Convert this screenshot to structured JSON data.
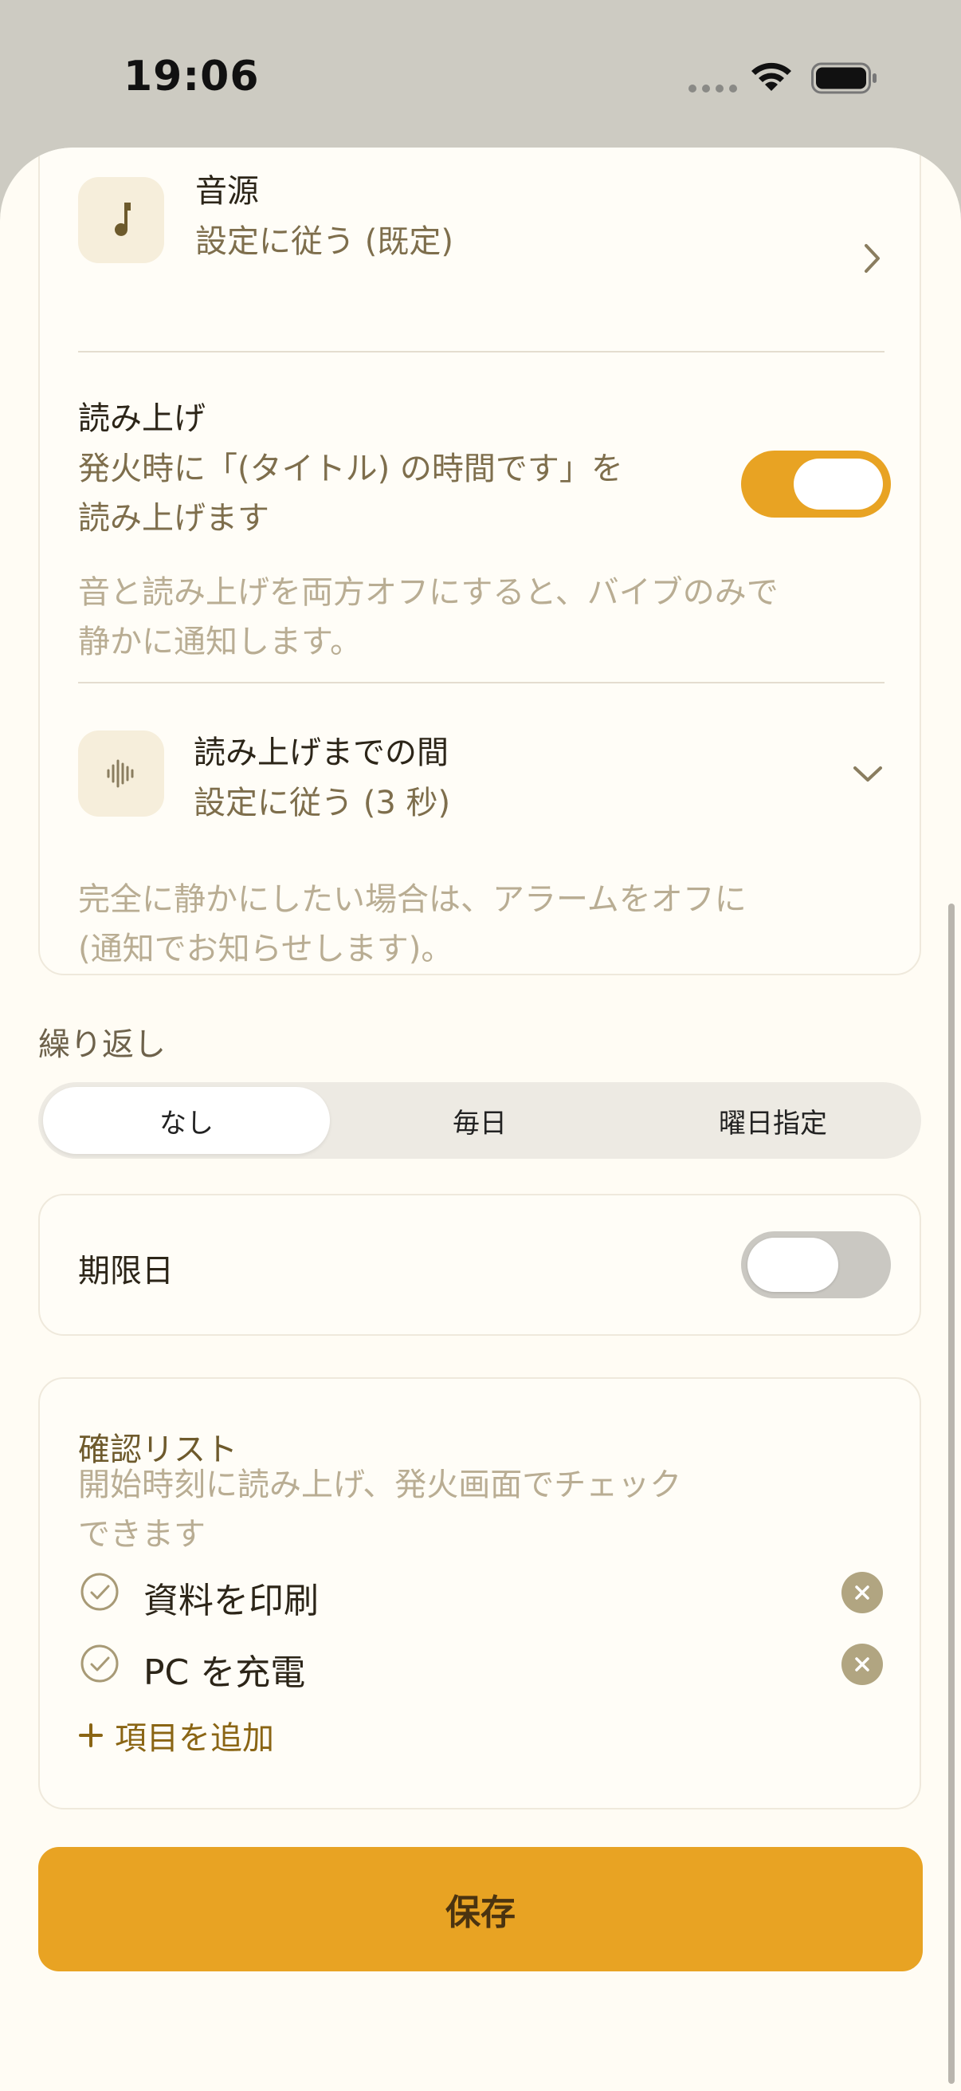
{
  "status_bar": {
    "time": "19:06"
  },
  "sound_row": {
    "title": "音源",
    "value": "設定に従う (既定)"
  },
  "readout_row": {
    "title": "読み上げ",
    "desc_line1": "発火時に「(タイトル) の時間です」を",
    "desc_line2": "読み上げます",
    "toggle_on": true
  },
  "readout_hint": {
    "line1": "音と読み上げを両方オフにすると、バイブのみで",
    "line2": "静かに通知します。"
  },
  "delay_row": {
    "title": "読み上げまでの間",
    "value": "設定に従う (3 秒)"
  },
  "silence_hint": {
    "line1": "完全に静かにしたい場合は、アラームをオフに",
    "line2": "(通知でお知らせします)。"
  },
  "repeat": {
    "label": "繰り返し",
    "options": [
      "なし",
      "毎日",
      "曜日指定"
    ],
    "selected": "なし"
  },
  "deadline": {
    "label": "期限日",
    "toggle_on": false
  },
  "checklist": {
    "title": "確認リスト",
    "desc_line1": "開始時刻に読み上げ、発火画面でチェック",
    "desc_line2": "できます",
    "items": [
      {
        "text": "資料を印刷"
      },
      {
        "text": "PC を充電"
      }
    ],
    "add_label": "項目を追加"
  },
  "save_label": "保存",
  "colors": {
    "accent": "#e8a323",
    "background": "#fffcf4",
    "muted_text": "#b9ad93",
    "secondary_text": "#7e6e4c"
  }
}
